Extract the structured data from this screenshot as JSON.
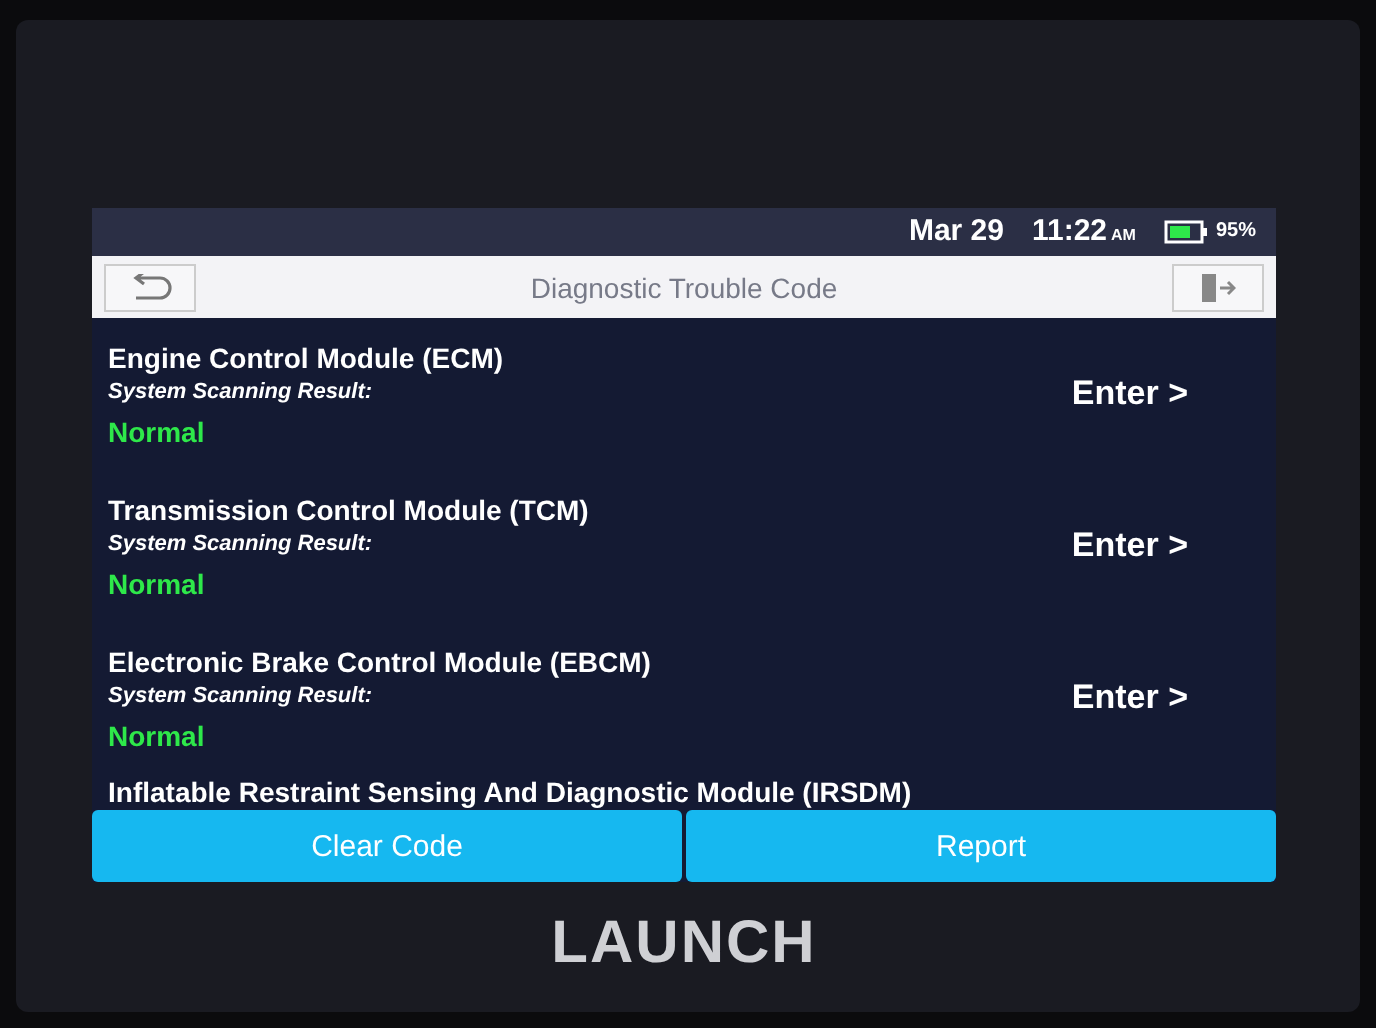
{
  "status_bar": {
    "date": "Mar 29",
    "time": "11:22",
    "meridiem": "AM",
    "battery": "95%"
  },
  "header": {
    "title": "Diagnostic Trouble Code"
  },
  "modules": [
    {
      "name": "Engine Control Module (ECM)",
      "result_label": "System Scanning Result:",
      "result": "Normal",
      "action": "Enter >"
    },
    {
      "name": "Transmission Control Module (TCM)",
      "result_label": "System Scanning Result:",
      "result": "Normal",
      "action": "Enter >"
    },
    {
      "name": "Electronic Brake Control Module (EBCM)",
      "result_label": "System Scanning Result:",
      "result": "Normal",
      "action": "Enter >"
    },
    {
      "name": "Inflatable Restraint Sensing And Diagnostic Module (IRSDM)"
    }
  ],
  "buttons": [
    "Clear Code",
    "Report"
  ],
  "brand": "LAUNCH"
}
